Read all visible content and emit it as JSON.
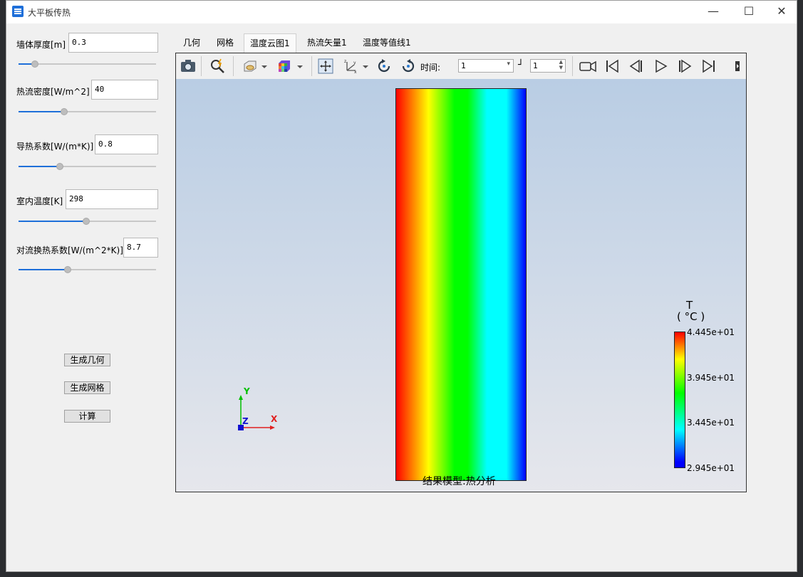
{
  "window": {
    "title": "大平板传热"
  },
  "params": [
    {
      "label": "墙体厚度[m]",
      "value": "0.3",
      "slider": 0.12
    },
    {
      "label": "热流密度[W/m^2]",
      "value": "40",
      "slider": 0.33
    },
    {
      "label": "导热系数[W/(m*K)]",
      "value": "0.8",
      "slider": 0.3
    },
    {
      "label": "室内温度[K]",
      "value": "298",
      "slider": 0.49
    },
    {
      "label": "对流换热系数[W/(m^2*K)]",
      "value": "8.7",
      "slider": 0.36
    }
  ],
  "buttons": {
    "geometry": "生成几何",
    "mesh": "生成网格",
    "compute": "计算"
  },
  "tabs": [
    "几何",
    "网格",
    "温度云图1",
    "热流矢量1",
    "温度等值线1"
  ],
  "active_tab": 2,
  "toolbar": {
    "time_label": "时间:",
    "time_value": "1",
    "step_value": "1"
  },
  "legend": {
    "title": "T",
    "unit": "( °C )",
    "max": "4.445e+01",
    "v2": "3.945e+01",
    "v3": "3.445e+01",
    "min": "2.945e+01"
  },
  "axes": {
    "y": "Y",
    "z": "Z",
    "x": "X"
  },
  "caption": "结果模型:热分析",
  "colors": {
    "accent": "#1e6fd9",
    "hot": "#ff0000",
    "cold": "#0000ff"
  }
}
